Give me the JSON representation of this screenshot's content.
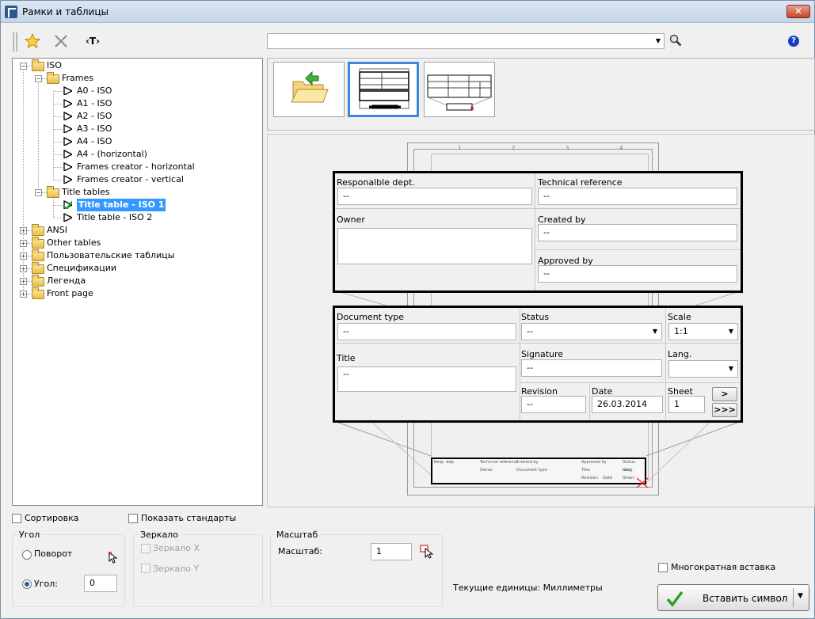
{
  "window": {
    "title": "Рамки и таблицы",
    "close": "✕"
  },
  "toolbar": {
    "tag_label": "‹T›",
    "search_value": "",
    "help": "?"
  },
  "tree": {
    "nodes": [
      {
        "label": "ISO",
        "level": 0,
        "type": "folder",
        "expanded": true
      },
      {
        "label": "Frames",
        "level": 1,
        "type": "folder",
        "expanded": true
      },
      {
        "label": "A0 - ISO",
        "level": 2,
        "type": "item"
      },
      {
        "label": "A1 - ISO",
        "level": 2,
        "type": "item"
      },
      {
        "label": "A2 - ISO",
        "level": 2,
        "type": "item"
      },
      {
        "label": "A3 - ISO",
        "level": 2,
        "type": "item"
      },
      {
        "label": "A4 - ISO",
        "level": 2,
        "type": "item"
      },
      {
        "label": "A4 - (horizontal)",
        "level": 2,
        "type": "item"
      },
      {
        "label": "Frames creator - horizontal",
        "level": 2,
        "type": "item"
      },
      {
        "label": "Frames creator - vertical",
        "level": 2,
        "type": "item"
      },
      {
        "label": "Title tables",
        "level": 1,
        "type": "folder",
        "expanded": true
      },
      {
        "label": "Title table - ISO 1",
        "level": 2,
        "type": "item",
        "selected": true
      },
      {
        "label": "Title table - ISO 2",
        "level": 2,
        "type": "item"
      },
      {
        "label": "ANSI",
        "level": 0,
        "type": "folder",
        "expanded": false
      },
      {
        "label": "Other tables",
        "level": 0,
        "type": "folder",
        "expanded": false
      },
      {
        "label": "Пользовательские таблицы",
        "level": 0,
        "type": "folder",
        "expanded": false
      },
      {
        "label": "Спецификации",
        "level": 0,
        "type": "folder",
        "expanded": false
      },
      {
        "label": "Легенда",
        "level": 0,
        "type": "folder",
        "expanded": false
      },
      {
        "label": "Front page",
        "level": 0,
        "type": "folder",
        "expanded": false
      }
    ]
  },
  "form_top": {
    "responsible_label": "Responalble dept.",
    "responsible_value": "--",
    "techref_label": "Technical reference",
    "techref_value": "--",
    "owner_label": "Owner",
    "owner_value": "",
    "created_label": "Created by",
    "created_value": "--",
    "approved_label": "Approved by",
    "approved_value": "--"
  },
  "form_bottom": {
    "doctype_label": "Document type",
    "doctype_value": "--",
    "status_label": "Status",
    "status_value": "--",
    "scale_label": "Scale",
    "scale_value": "1:1",
    "title_label": "Title",
    "title_value": "--",
    "signature_label": "Signature",
    "signature_value": "--",
    "lang_label": "Lang.",
    "lang_value": "",
    "revision_label": "Revision",
    "revision_value": "--",
    "date_label": "Date",
    "date_value": "26.03.2014",
    "sheet_label": "Sheet",
    "sheet_value": "1",
    "next_btn": ">",
    "last_btn": ">>>"
  },
  "frame_ticks": [
    "1",
    "2",
    "3",
    "4"
  ],
  "mini_table": {
    "r1": [
      "Resp. dep.",
      "Technical reference",
      "Created by",
      "Approved by",
      "Status"
    ],
    "r2": [
      "Owner",
      "Document type",
      "Title",
      "Lang.",
      "Rev."
    ],
    "r3": [
      "Revision",
      "Date",
      "Sheet"
    ]
  },
  "options": {
    "sort_label": "Сортировка",
    "show_standards_label": "Показать стандарты",
    "multi_insert_label": "Многократная вставка"
  },
  "angle_group": {
    "title": "Угол",
    "rotation_label": "Поворот",
    "angle_label": "Угол:",
    "angle_value": "0"
  },
  "mirror_group": {
    "title": "Зеркало",
    "mirror_x": "Зеркало X",
    "mirror_y": "Зеркало Y"
  },
  "scale_group": {
    "title": "Масштаб",
    "scale_label": "Масштаб:",
    "scale_value": "1"
  },
  "units_text": "Текущие единицы: Миллиметры",
  "insert_button": {
    "label": "Вставить символ",
    "arrow": "▼"
  }
}
